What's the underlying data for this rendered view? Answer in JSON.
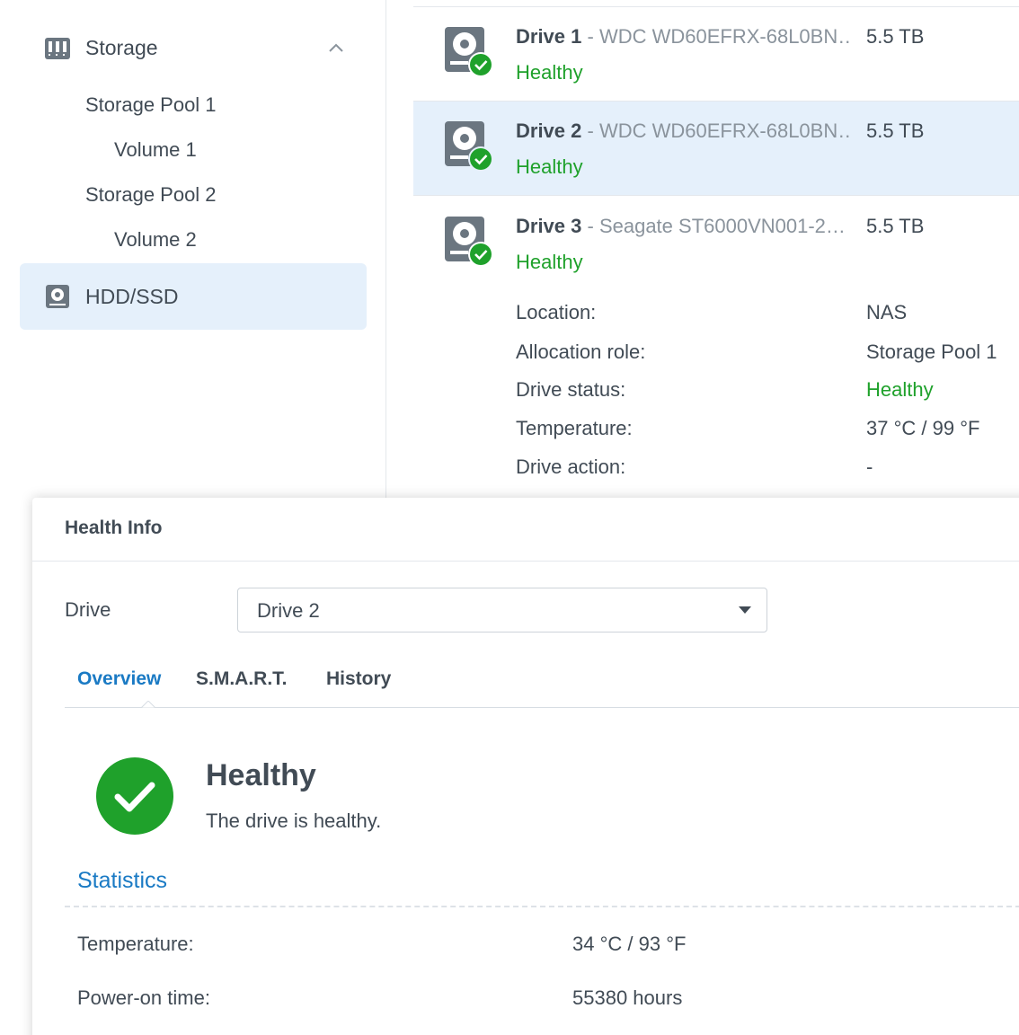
{
  "sidebar": {
    "storage_label": "Storage",
    "items": [
      {
        "label": "Storage Pool 1"
      },
      {
        "label": "Volume 1"
      },
      {
        "label": "Storage Pool 2"
      },
      {
        "label": "Volume 2"
      }
    ],
    "hdd_label": "HDD/SSD"
  },
  "drives": [
    {
      "name": "Drive 1",
      "model": " - WDC WD60EFRX-68L0BN…",
      "size": "5.5 TB",
      "status": "Healthy"
    },
    {
      "name": "Drive 2",
      "model": " - WDC WD60EFRX-68L0BN…",
      "size": "5.5 TB",
      "status": "Healthy"
    },
    {
      "name": "Drive 3",
      "model": " - Seagate ST6000VN001-2…",
      "size": "5.5 TB",
      "status": "Healthy"
    }
  ],
  "details": {
    "location_label": "Location:",
    "location_value": "NAS",
    "role_label": "Allocation role:",
    "role_value": "Storage Pool 1",
    "status_label": "Drive status:",
    "status_value": "Healthy",
    "temp_label": "Temperature:",
    "temp_value": "37 °C / 99 °F",
    "action_label": "Drive action:",
    "action_value": "-"
  },
  "dialog": {
    "title": "Health Info",
    "drive_label": "Drive",
    "drive_selected": "Drive 2",
    "tabs": [
      "Overview",
      "S.M.A.R.T.",
      "History"
    ],
    "active_tab": "Overview",
    "health_title": "Healthy",
    "health_desc": "The drive is healthy.",
    "statistics_title": "Statistics",
    "stats": [
      {
        "label": "Temperature:",
        "value": "34 °C / 93 °F"
      },
      {
        "label": "Power-on time:",
        "value": "55380 hours"
      }
    ]
  },
  "colors": {
    "accent": "#1a7ac4",
    "healthy": "#1fa12b",
    "selected_bg": "#e5f0fb",
    "icon_gray": "#6b7680"
  },
  "icons": {
    "storage": "storage-icon",
    "chevron": "chevron-up-icon",
    "hdd": "hdd-icon",
    "drive_status": "drive-healthy-icon",
    "check": "check-circle-icon",
    "caret": "caret-down-icon"
  }
}
